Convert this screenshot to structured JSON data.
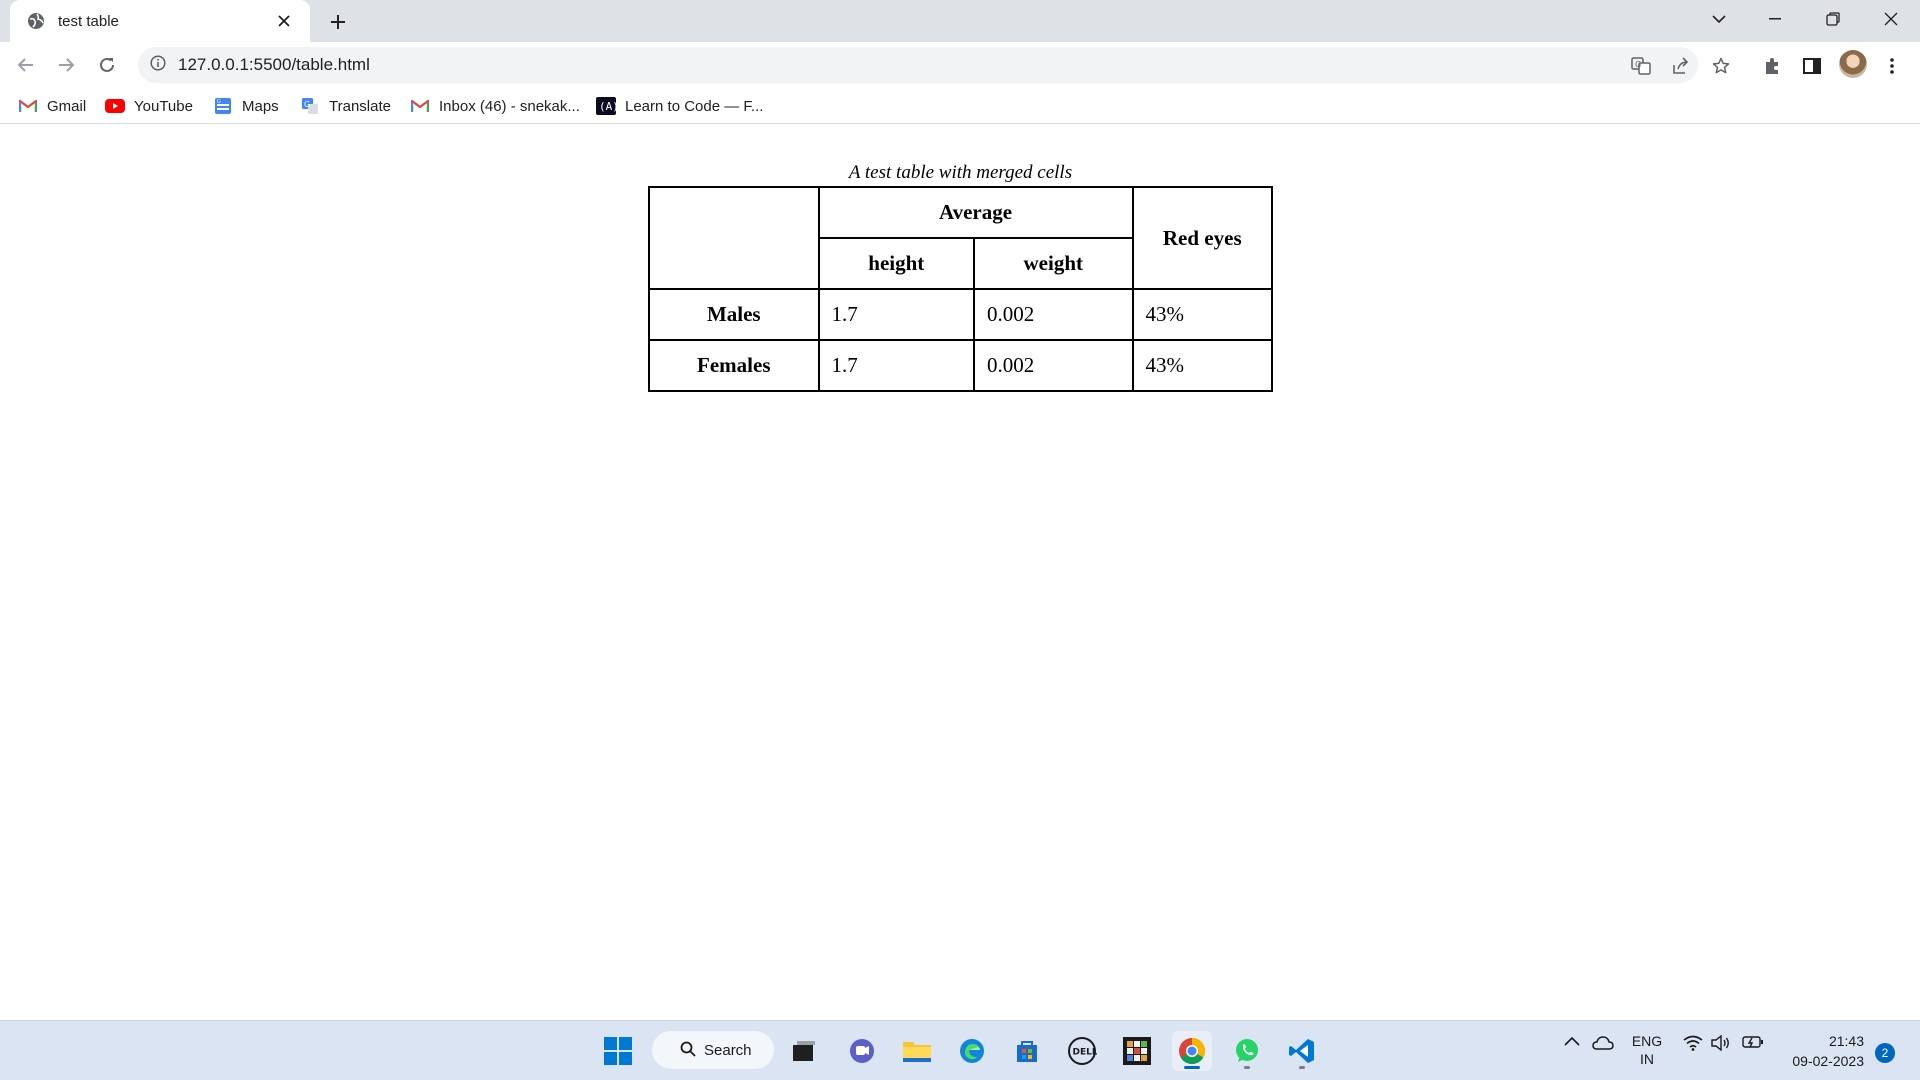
{
  "browser": {
    "tab_title": "test table",
    "url": "127.0.0.1:5500/table.html"
  },
  "bookmarks": [
    {
      "label": "Gmail",
      "icon": "gmail-icon"
    },
    {
      "label": "YouTube",
      "icon": "youtube-icon"
    },
    {
      "label": "Maps",
      "icon": "maps-icon"
    },
    {
      "label": "Translate",
      "icon": "translate-icon"
    },
    {
      "label": "Inbox (46) - snekak...",
      "icon": "gmail-icon"
    },
    {
      "label": "Learn to Code — F...",
      "icon": "freecodecamp-icon"
    }
  ],
  "table": {
    "caption": "A test table with merged cells",
    "header": {
      "average": "Average",
      "red_eyes": "Red eyes",
      "height": "height",
      "weight": "weight"
    },
    "rows": [
      {
        "label": "Males",
        "height": "1.7",
        "weight": "0.002",
        "red_eyes": "43%"
      },
      {
        "label": "Females",
        "height": "1.7",
        "weight": "0.002",
        "red_eyes": "43%"
      }
    ]
  },
  "taskbar": {
    "search_label": "Search",
    "lang_top": "ENG",
    "lang_bottom": "IN",
    "time": "21:43",
    "date": "09-02-2023",
    "notification_count": "2"
  },
  "colors": {
    "tabstrip": "#dee1e6",
    "taskbar": "#dbe4f3",
    "accent": "#0067c0"
  }
}
